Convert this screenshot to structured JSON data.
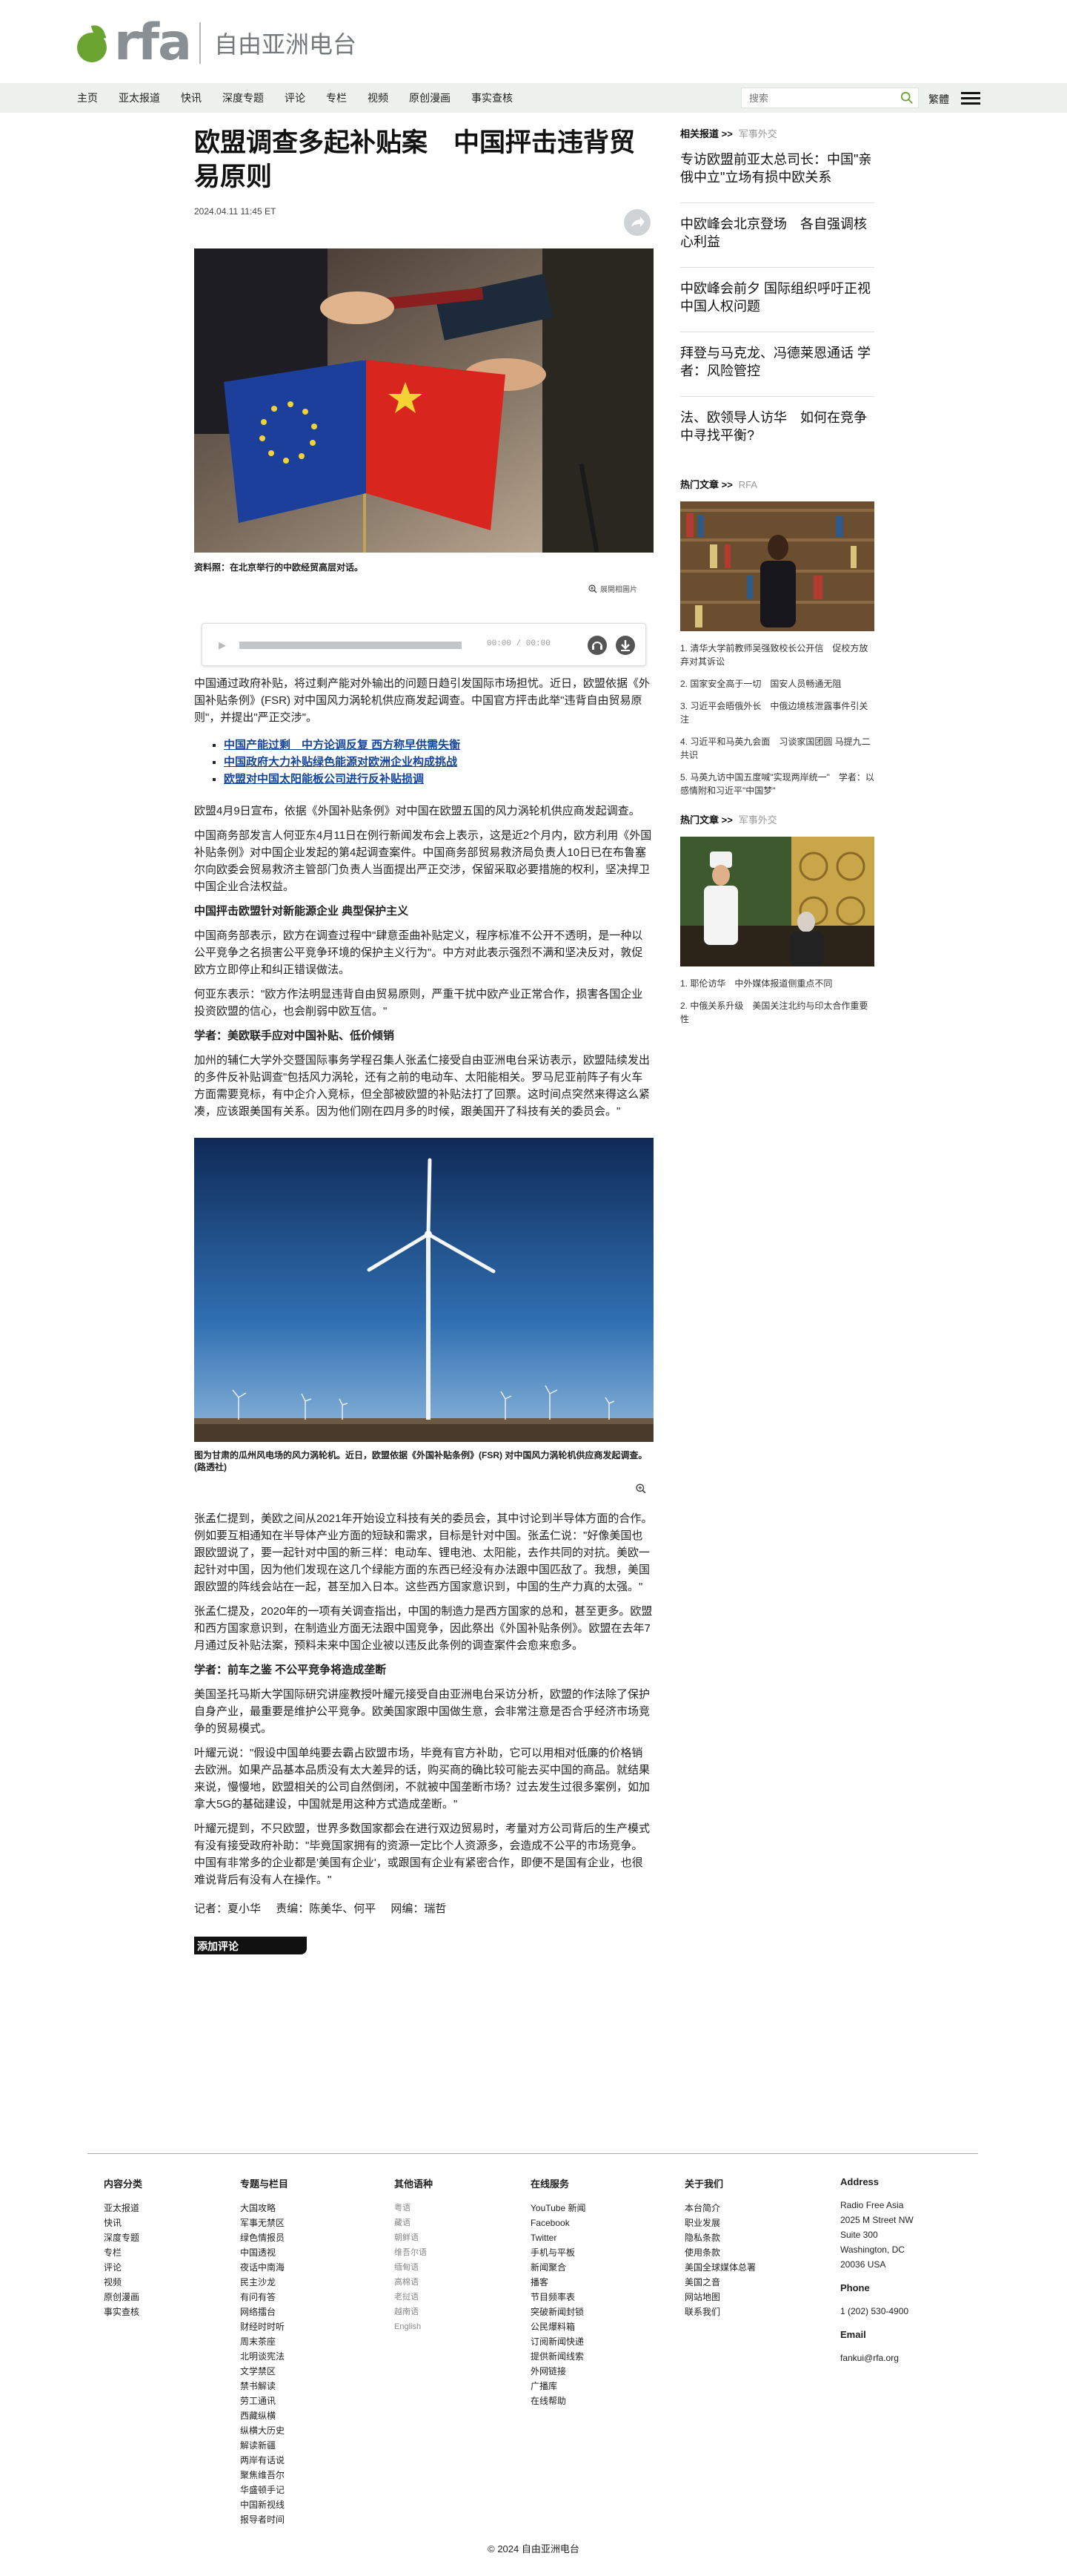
{
  "brand": {
    "logo_text": "rfa",
    "name_cn": "自由亚洲电台"
  },
  "nav": {
    "items": [
      "主页",
      "亚太报道",
      "快讯",
      "深度专题",
      "评论",
      "专栏",
      "视频",
      "原创漫画",
      "事实查核"
    ],
    "search_placeholder": "搜索",
    "lang": "繁體"
  },
  "article": {
    "title": "欧盟调查多起补贴案　中国抨击违背贸易原则",
    "date": "2024.04.11 11:45 ET",
    "caption1": "资料照：在北京举行的中欧经贸高层对话。",
    "enlarge": "展開相圖片",
    "audio_time": "00:00 / 00:00",
    "p1": "中国通过政府补贴，将过剩产能对外输出的问题日趋引发国际市场担忧。近日，欧盟依据《外国补贴条例》(FSR) 对中国风力涡轮机供应商发起调查。中国官方抨击此举\"违背自由贸易原则\"，并提出\"严正交涉\"。",
    "links": [
      "中国产能过剩　中方论调反复 西方称早供需失衡",
      "中国政府大力补贴绿色能源对欧洲企业构成挑战",
      "欧盟对中国太阳能板公司进行反补贴损调"
    ],
    "p2": "欧盟4月9日宣布，依据《外国补贴条例》对中国在欧盟五国的风力涡轮机供应商发起调查。",
    "p3": "中国商务部发言人何亚东4月11日在例行新闻发布会上表示，这是近2个月内，欧方利用《外国补贴条例》对中国企业发起的第4起调查案件。中国商务部贸易救济局负责人10日已在布鲁塞尔向欧委会贸易救济主管部门负责人当面提出严正交涉，保留采取必要措施的权利，坚决捍卫中国企业合法权益。",
    "h1": "中国抨击欧盟针对新能源企业 典型保护主义",
    "p4": "中国商务部表示，欧方在调查过程中\"肆意歪曲补贴定义，程序标准不公开不透明，是一种以公平竞争之名损害公平竞争环境的保护主义行为\"。中方对此表示强烈不满和坚决反对，敦促欧方立即停止和纠正错误做法。",
    "p5": "何亚东表示：\"欧方作法明显违背自由贸易原则，严重干扰中欧产业正常合作，损害各国企业投资欧盟的信心，也会削弱中欧互信。\"",
    "h2": "学者：美欧联手应对中国补贴、低价倾销",
    "p6": "加州的辅仁大学外交暨国际事务学程召集人张孟仁接受自由亚洲电台采访表示，欧盟陆续发出的多件反补贴调查\"包括风力涡轮，还有之前的电动车、太阳能相关。罗马尼亚前阵子有火车方面需要竞标，有中企介入竞标，但全部被欧盟的补贴法打了回票。这时间点突然来得这么紧凑，应该跟美国有关系。因为他们刚在四月多的时候，跟美国开了科技有关的委员会。\"",
    "caption2": "图为甘肃的瓜州风电场的风力涡轮机。近日，欧盟依据《外国补贴条例》(FSR) 对中国风力涡轮机供应商发起调查。(路透社)",
    "p7": "张孟仁提到，美欧之间从2021年开始设立科技有关的委员会，其中讨论到半导体方面的合作。例如要互相通知在半导体产业方面的短缺和需求，目标是针对中国。张孟仁说：\"好像美国也跟欧盟说了，要一起针对中国的新三样：电动车、锂电池、太阳能，去作共同的对抗。美欧一起针对中国，因为他们发现在这几个绿能方面的东西已经没有办法跟中国匹敌了。我想，美国跟欧盟的阵线会站在一起，甚至加入日本。这些西方国家意识到，中国的生产力真的太强。\"",
    "p8": "张孟仁提及，2020年的一项有关调查指出，中国的制造力是西方国家的总和，甚至更多。欧盟和西方国家意识到，在制造业方面无法跟中国竞争，因此祭出《外国补贴条例》。欧盟在去年7月通过反补贴法案，预料未来中国企业被以违反此条例的调查案件会愈来愈多。",
    "h3": "学者：前车之鉴 不公平竞争将造成垄断",
    "p9": "美国圣托马斯大学国际研究讲座教授叶耀元接受自由亚洲电台采访分析，欧盟的作法除了保护自身产业，最重要是维护公平竞争。欧美国家跟中国做生意，会非常注意是否合乎经济市场竞争的贸易模式。",
    "p10": "叶耀元说：\"假设中国单纯要去霸占欧盟市场，毕竟有官方补助，它可以用相对低廉的价格销去欧洲。如果产品基本品质没有太大差异的话，购买商的确比较可能去买中国的商品。就结果来说，慢慢地，欧盟相关的公司自然倒闭，不就被中国垄断市场？过去发生过很多案例，如加拿大5G的基础建设，中国就是用这种方式造成垄断。\"",
    "p11": "叶耀元提到，不只欧盟，世界多数国家都会在进行双边贸易时，考量对方公司背后的生产模式有没有接受政府补助：\"毕竟国家拥有的资源一定比个人资源多，会造成不公平的市场竞争。中国有非常多的企业都是'美国有企业'，或跟国有企业有紧密合作，即便不是国有企业，也很难说背后有没有人在操作。\"",
    "credits": [
      "记者：夏小华",
      "责编：陈美华、何平",
      "网编：瑞哲"
    ],
    "comment_btn": "添加评论"
  },
  "sidebar": {
    "related_head": "相关报道 >>",
    "related_sub": "军事外交",
    "related": [
      "专访欧盟前亚太总司长：中国\"亲俄中立\"立场有损中欧关系",
      "中欧峰会北京登场　各自强调核心利益",
      "中欧峰会前夕 国际组织呼吁正视中国人权问题",
      "拜登与马克龙、冯德莱恩通话 学者：风险管控",
      "法、欧领导人访华　如何在竞争中寻找平衡?"
    ],
    "hot_head": "热门文章 >>",
    "hot_sub": "RFA",
    "hot": [
      "1. 清华大学前教师吴强致校长公开信　促校方放弃对其诉讼",
      "2. 国家安全高于一切　国安人员畅通无阻",
      "3. 习近平会晤俄外长　中俄边境核泄露事件引关注",
      "4. 习近平和马英九会面　习谈家国团圆 马提九二共识",
      "5. 马英九访中国五度喊\"实现两岸统一\"　学者：以感情附和习近平\"中国梦\""
    ],
    "hot2_head": "热门文章 >>",
    "hot2_sub": "军事外交",
    "hot2": [
      "1. 耶伦访华　中外媒体报道侧重点不同",
      "2. 中俄关系升级　美国关注北约与印太合作重要性"
    ]
  },
  "footer": {
    "cols": [
      {
        "head": "内容分类",
        "items": [
          "亚太报道",
          "快讯",
          "深度专题",
          "专栏",
          "评论",
          "视频",
          "原创漫画",
          "事实查核"
        ]
      },
      {
        "head": "专题与栏目",
        "items": [
          "大国攻略",
          "军事无禁区",
          "绿色情报员",
          "中国透视",
          "夜话中南海",
          "民主沙龙",
          "有问有答",
          "网络擂台",
          "财经时时听",
          "周末茶座",
          "北明谈宪法",
          "文学禁区",
          "禁书解读",
          "劳工通讯",
          "西藏纵横",
          "纵横大历史",
          "解读新疆",
          "两岸有话说",
          "聚焦维吾尔",
          "华盛顿手记",
          "中国新视线",
          "报导者时间"
        ]
      },
      {
        "head": "其他语种",
        "items": [
          "粤语",
          "藏语",
          "朝鲜语",
          "维吾尔语",
          "缅甸语",
          "高棉语",
          "老挝语",
          "越南语",
          "English"
        ]
      },
      {
        "head": "在线服务",
        "items": [
          "YouTube 新闻",
          "Facebook",
          "Twitter",
          "手机与平板",
          "新闻聚合",
          "播客",
          "节目频率表",
          "突破新闻封锁",
          "公民爆料箱",
          "订阅新闻快递",
          "提供新闻线索",
          "外网链接",
          "广播库",
          "在线帮助"
        ]
      },
      {
        "head": "关于我们",
        "items": [
          "本台简介",
          "职业发展",
          "隐私条款",
          "使用条款",
          "美国全球媒体总署",
          "美国之音",
          "网站地图",
          "联系我们"
        ]
      }
    ],
    "address_head": "Address",
    "address": [
      "Radio Free Asia",
      "2025 M Street NW",
      "Suite 300",
      "Washington, DC",
      "20036 USA"
    ],
    "phone_head": "Phone",
    "phone": "1 (202) 530-4900",
    "email_head": "Email",
    "email": "fankui@rfa.org",
    "copyright": "© 2024 自由亚洲电台"
  }
}
